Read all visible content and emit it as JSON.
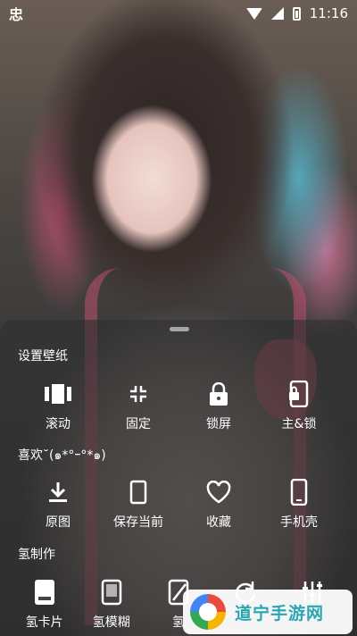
{
  "status_bar": {
    "left_glyph": "忠",
    "time": "11:16"
  },
  "sections": [
    {
      "title": "设置壁纸",
      "items": [
        {
          "label": "滚动",
          "icon": "scroll-icon"
        },
        {
          "label": "固定",
          "icon": "fixed-icon"
        },
        {
          "label": "锁屏",
          "icon": "lock-icon"
        },
        {
          "label": "主&锁",
          "icon": "home-lock-icon"
        }
      ]
    },
    {
      "title": "喜欢˘(๑*°ｰ°*๑)",
      "items": [
        {
          "label": "原图",
          "icon": "download-icon"
        },
        {
          "label": "保存当前",
          "icon": "save-current-icon"
        },
        {
          "label": "收藏",
          "icon": "heart-icon"
        },
        {
          "label": "手机壳",
          "icon": "phone-case-icon"
        }
      ]
    },
    {
      "title": "氢制作",
      "items": [
        {
          "label": "氢卡片",
          "icon": "card-icon"
        },
        {
          "label": "氢模糊",
          "icon": "blur-icon"
        },
        {
          "label": "氢",
          "icon": "edit-icon"
        },
        {
          "label": "",
          "icon": "rotate-icon"
        },
        {
          "label": "",
          "icon": "equalizer-icon"
        }
      ]
    }
  ],
  "watermark": {
    "text": "道宁手游网"
  },
  "colors": {
    "sheet": "#303030",
    "accent_watermark": "#2aa6b3"
  }
}
